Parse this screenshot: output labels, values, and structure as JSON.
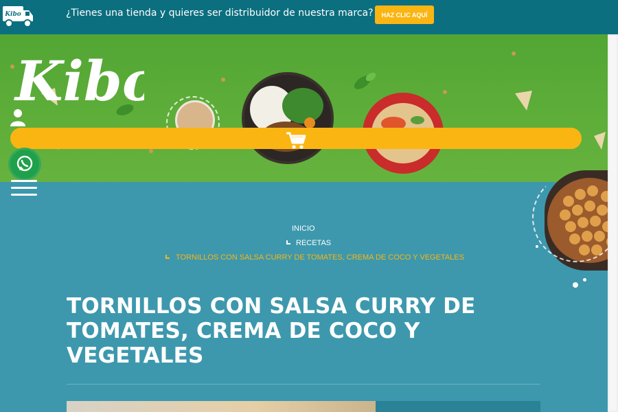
{
  "topbar": {
    "logo_text": "Kibo",
    "message": "¿Tienes una tienda y quieres ser distribuidor de nuestra marca?",
    "cta_label": "HAZ CLIC AQUÍ"
  },
  "brand": {
    "logo_text": "Kibo"
  },
  "breadcrumb": {
    "items": [
      "INICIO",
      "RECETAS",
      "TORNILLOS CON SALSA CURRY DE TOMATES, CREMA DE COCO Y VEGETALES"
    ]
  },
  "page": {
    "title": "TORNILLOS CON SALSA CURRY DE TOMATES, CREMA DE COCO Y VEGETALES"
  },
  "icons": {
    "truck": "truck-icon",
    "user": "user-icon",
    "cart": "cart-icon",
    "whatsapp": "whatsapp-icon",
    "menu": "menu-icon"
  },
  "colors": {
    "topbar": "#0b6f7f",
    "accent": "#fbb512",
    "hero_green": "#5aaa38",
    "page_blue": "#3d98ad",
    "whatsapp": "#1fa04a",
    "breadcrumb_active": "#fbb512"
  }
}
